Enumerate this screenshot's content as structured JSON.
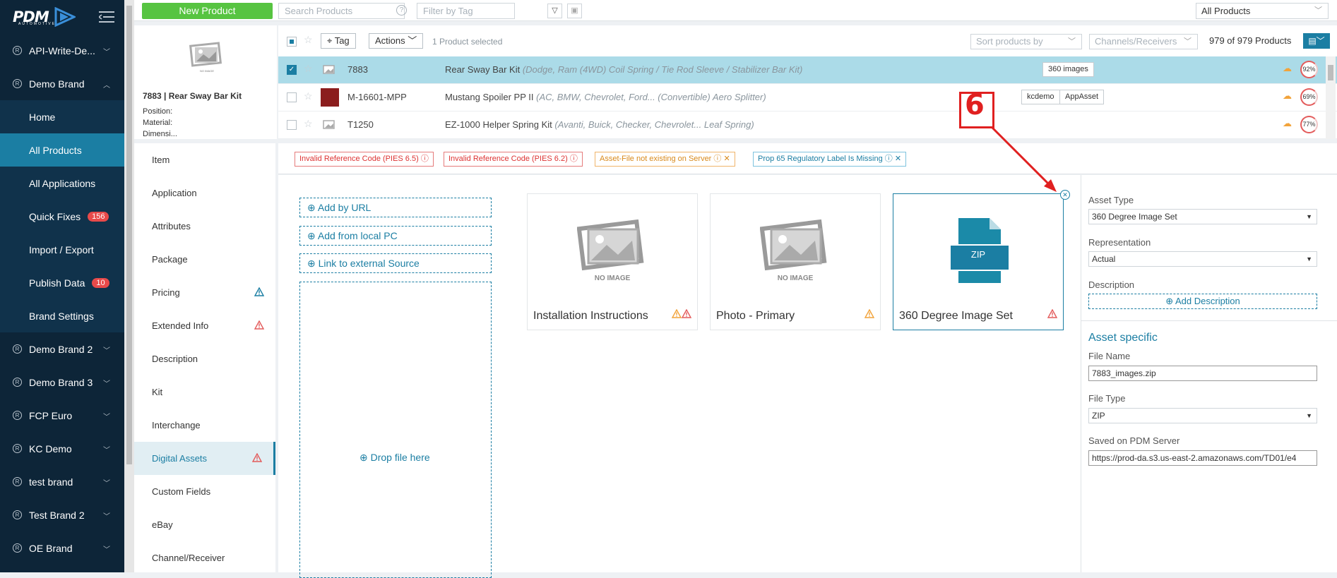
{
  "colors": {
    "accent": "#1b7ea3",
    "green": "#57c441",
    "sidebar": "#0d2538",
    "warn_red": "#e35b5b",
    "warn_orange": "#f2a33a",
    "annotation": "#e02020"
  },
  "sidebar": {
    "logo": "PDM",
    "logo_sub": "AUTOMOTIVE",
    "items": [
      {
        "label": "API-Write-De...",
        "type": "brand"
      },
      {
        "label": "Demo Brand",
        "type": "brand",
        "expanded": true
      },
      {
        "label": "Home",
        "type": "sub"
      },
      {
        "label": "All Products",
        "type": "sub",
        "active": true
      },
      {
        "label": "All Applications",
        "type": "sub"
      },
      {
        "label": "Quick Fixes",
        "type": "sub",
        "badge": "156"
      },
      {
        "label": "Import / Export",
        "type": "sub"
      },
      {
        "label": "Publish Data",
        "type": "sub",
        "badge": "10"
      },
      {
        "label": "Brand Settings",
        "type": "sub"
      },
      {
        "label": "Demo Brand 2",
        "type": "brand"
      },
      {
        "label": "Demo Brand 3",
        "type": "brand"
      },
      {
        "label": "FCP Euro",
        "type": "brand"
      },
      {
        "label": "KC Demo",
        "type": "brand"
      },
      {
        "label": "test brand",
        "type": "brand"
      },
      {
        "label": "Test Brand 2",
        "type": "brand"
      },
      {
        "label": "OE Brand",
        "type": "brand"
      }
    ]
  },
  "topbar": {
    "new_product": "New Product",
    "search_placeholder": "Search Products",
    "filter_placeholder": "Filter by Tag",
    "all_products": "All Products"
  },
  "product_panel": {
    "noimage": "NO IMAGE",
    "title": "7883 | Rear Sway Bar Kit",
    "position": "Position:",
    "material": "Material:",
    "more": "Dimensi..."
  },
  "list_header": {
    "tag": "Tag",
    "actions": "Actions",
    "selected": "1 Product selected",
    "sort": "Sort products by",
    "channels": "Channels/Receivers",
    "count": "979 of 979 Products"
  },
  "products": [
    {
      "sku": "7883",
      "name": "Rear Sway Bar Kit",
      "detail": "(Dodge, Ram (4WD) Coil Spring / Tie Rod Sleeve / Stabilizer Bar Kit)",
      "tags": [
        "360 images"
      ],
      "pct": "92%",
      "selected": true
    },
    {
      "sku": "M-16601-MPP",
      "name": "Mustang Spoiler PP II",
      "detail": "(AC, BMW, Chevrolet, Ford... (Convertible) Aero Splitter)",
      "tags": [
        "kcdemo",
        "AppAsset"
      ],
      "pct": "69%",
      "selected": false
    },
    {
      "sku": "T1250",
      "name": "EZ-1000 Helper Spring Kit",
      "detail": "(Avanti, Buick, Checker, Chevrolet... Leaf Spring)",
      "tags": [],
      "pct": "77%",
      "selected": false
    }
  ],
  "tabs": [
    "Item",
    "Application",
    "Attributes",
    "Package",
    "Pricing",
    "Extended Info",
    "Description",
    "Kit",
    "Interchange",
    "Digital Assets",
    "Custom Fields",
    "eBay",
    "Channel/Receiver"
  ],
  "alerts": [
    {
      "text": "Invalid Reference Code (PIES 6.5)",
      "type": "red"
    },
    {
      "text": "Invalid Reference Code (PIES 6.2)",
      "type": "red"
    },
    {
      "text": "Asset-File not existing on Server",
      "type": "orange"
    },
    {
      "text": "Prop 65 Regulatory Label Is Missing",
      "type": "blue"
    }
  ],
  "asset_actions": {
    "add_url": "Add by URL",
    "add_local": "Add from local PC",
    "link_ext": "Link to external Source",
    "drop": "Drop file here"
  },
  "asset_cards": [
    {
      "label": "Installation Instructions",
      "image": "NO IMAGE"
    },
    {
      "label": "Photo - Primary",
      "image": "NO IMAGE"
    },
    {
      "label": "360 Degree Image Set",
      "image": "ZIP"
    }
  ],
  "right_panel": {
    "asset_type_label": "Asset Type",
    "asset_type": "360 Degree Image Set",
    "representation_label": "Representation",
    "representation": "Actual",
    "description_label": "Description",
    "add_description": "Add Description",
    "asset_specific": "Asset specific",
    "file_name_label": "File Name",
    "file_name": "7883_images.zip",
    "file_type_label": "File Type",
    "file_type": "ZIP",
    "saved_label": "Saved on PDM Server",
    "saved_url": "https://prod-da.s3.us-east-2.amazonaws.com/TD01/e4"
  },
  "annotation": {
    "number": "6"
  }
}
